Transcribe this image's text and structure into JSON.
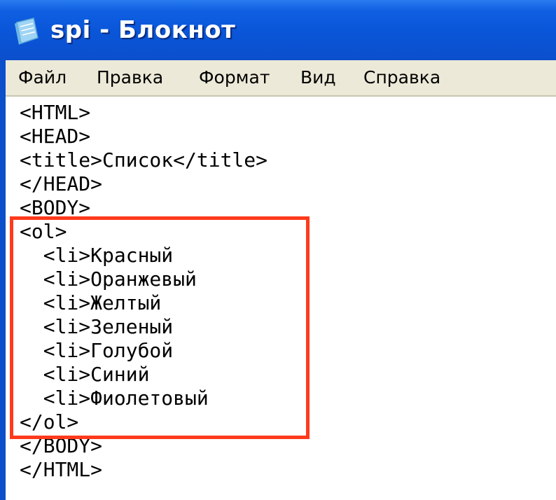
{
  "window": {
    "title": "spi - Блокнот",
    "icon": "notepad-icon"
  },
  "menu": {
    "items": [
      "Файл",
      "Правка",
      "Формат",
      "Вид",
      "Справка"
    ]
  },
  "editor": {
    "lines": [
      "<HTML>",
      "<HEAD>",
      "<title>Список</title>",
      "</HEAD>",
      "<BODY>",
      "<ol>",
      "  <li>Красный",
      "  <li>Оранжевый",
      "  <li>Желтый",
      "  <li>Зеленый",
      "  <li>Голубой",
      "  <li>Синий",
      "  <li>Фиолетовый",
      "</ol>",
      "</BODY>",
      "</HTML>"
    ]
  },
  "colors": {
    "titlebar": "#0a55d8",
    "menubar": "#ece9d8",
    "highlight": "#ff3a1c"
  }
}
